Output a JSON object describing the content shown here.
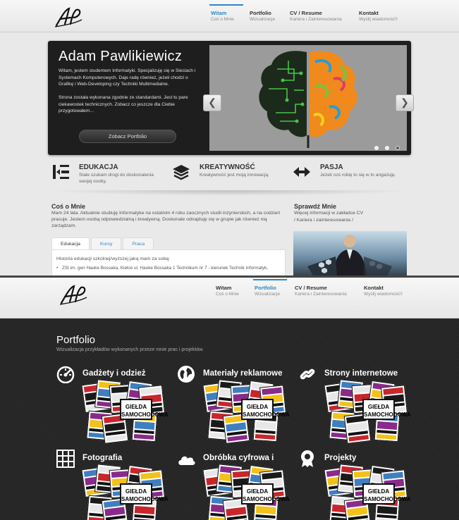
{
  "nav": {
    "items": [
      {
        "title": "Witam",
        "sub": "Coś o Mnie"
      },
      {
        "title": "Portfolio",
        "sub": "Wizualizacje"
      },
      {
        "title": "CV / Resume",
        "sub": "Kariera i Zainteresowania"
      },
      {
        "title": "Kontakt",
        "sub": "Wyślij wiadomość!!"
      }
    ]
  },
  "hero": {
    "title": "Adam Pawlikiewicz",
    "p1": "Witam, jestem studentem Informatyki. Specjalizuję się w Sieciach i Systemach Komputerowych. Daje radę również, jeżeli chodzi o Grafikę i Web-Developing czy Techniki Multimedialne.",
    "p2": "Strona została wykonana zgodnie ze standardami. Jest tu pare ciekawostek technicznych. Zobacz co jeszcze dla Ciebie przygotowałem...",
    "button": "Zobacz Portfolio",
    "prev": "❮",
    "next": "❯"
  },
  "features": [
    {
      "title": "EDUKACJA",
      "desc": "Stale szukam drogi do doskonalenia swojej osoby.",
      "icon": "indent-arrow-icon"
    },
    {
      "title": "KREATYWNOŚĆ",
      "desc": "Kreatywność jest moją innowacją.",
      "icon": "layers-icon"
    },
    {
      "title": "PASJA",
      "desc": "Jeżeli coś robię to się w to angażuję.",
      "icon": "horizontal-arrows-icon"
    }
  ],
  "about": {
    "title": "Coś o Mnie",
    "text": "Mam 24 lata. Aktualnie studiuję Informatyke na ostatnim 4 roku zaocznych studii inżynierskich, a na codzień pracuje. Jestem osobą odpowiedzialną i kreatywną. Doskonale odnajduję się w grupie jak również nią zarządzam.",
    "tabs": [
      "Edukacja",
      "Kursy",
      "Praca"
    ],
    "panel_text": "Historia edukacji szkolnej/wyższej jaką mam za sobą:",
    "panel_item": "ZSI im. gen Hauke Bossaka, Kielce ul. Hauke Bossaka 1 Technikum nr 7 - kierunek Technik Informatyk,"
  },
  "check": {
    "title": "Sprawdź Mnie",
    "line1": "Więcej informacji w zakładce CV",
    "line2": "/ Kariera i zainteresowania /"
  },
  "portfolio": {
    "title": "Portfolio",
    "subtitle": "Wizualizacja przykładów wykonanych przeze mnie prac i projektów.",
    "flyer_text": "GIEŁDA SAMOCHODOWA",
    "categories": [
      {
        "name": "Gadżety i odzież",
        "icon": "speedometer-icon"
      },
      {
        "name": "Materiały reklamowe",
        "icon": "globe-icon"
      },
      {
        "name": "Strony internetowe",
        "icon": "link-icon"
      },
      {
        "name": "Fotografia",
        "icon": "grid-icon"
      },
      {
        "name": "Obróbka cyfrowa i retusz",
        "icon": "cloud-icon"
      },
      {
        "name": "Projekty",
        "icon": "award-icon"
      }
    ]
  },
  "colors": {
    "accent": "#2f87c8",
    "dark_bg": "#262626"
  }
}
